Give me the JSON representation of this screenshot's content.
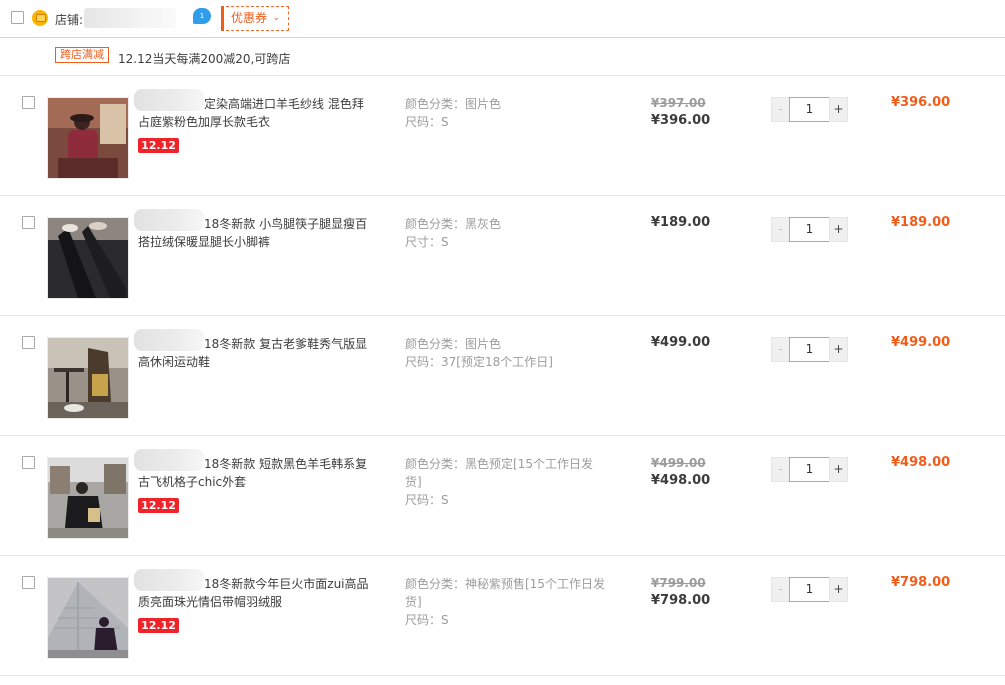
{
  "shop": {
    "label": "店铺:",
    "name_suffix": "3",
    "ww_badge": "1",
    "coupon_label": "优惠券",
    "coupon_caret": "⌄"
  },
  "promo": {
    "tag": "跨店满减",
    "text": "12.12当天每满200减20,可跨店"
  },
  "badge_text": "12.12",
  "qty_minus": "-",
  "qty_plus": "+",
  "items": [
    {
      "title": "定染高端进口羊毛纱线 混色拜占庭紫粉色加厚长款毛衣",
      "sku1": "颜色分类：图片色",
      "sku2": "尺码：S",
      "price_old": "¥397.00",
      "price": "¥396.00",
      "qty": "1",
      "subtotal": "¥396.00",
      "badge": true
    },
    {
      "title": "18冬新款 小鸟腿筷子腿显瘦百搭拉绒保暖显腿长小脚裤",
      "sku1": "颜色分类：黑灰色",
      "sku2": "尺寸：S",
      "price_old": "",
      "price": "¥189.00",
      "qty": "1",
      "subtotal": "¥189.00",
      "badge": false
    },
    {
      "title": "18冬新款 复古老爹鞋秀气版显高休闲运动鞋",
      "sku1": "颜色分类：图片色",
      "sku2": "尺码：37[预定18个工作日]",
      "price_old": "",
      "price": "¥499.00",
      "qty": "1",
      "subtotal": "¥499.00",
      "badge": false
    },
    {
      "title": "18冬新款 短款黑色羊毛韩系复古飞机格子chic外套",
      "sku1": "颜色分类：黑色预定[15个工作日发货]",
      "sku2": "尺码：S",
      "price_old": "¥499.00",
      "price": "¥498.00",
      "qty": "1",
      "subtotal": "¥498.00",
      "badge": true
    },
    {
      "title": "18冬新款今年巨火市面zui高品质亮面珠光情侣带帽羽绒服",
      "sku1": "颜色分类：神秘紫预售[15个工作日发货]",
      "sku2": "尺码：S",
      "price_old": "¥799.00",
      "price": "¥798.00",
      "qty": "1",
      "subtotal": "¥798.00",
      "badge": true
    }
  ]
}
